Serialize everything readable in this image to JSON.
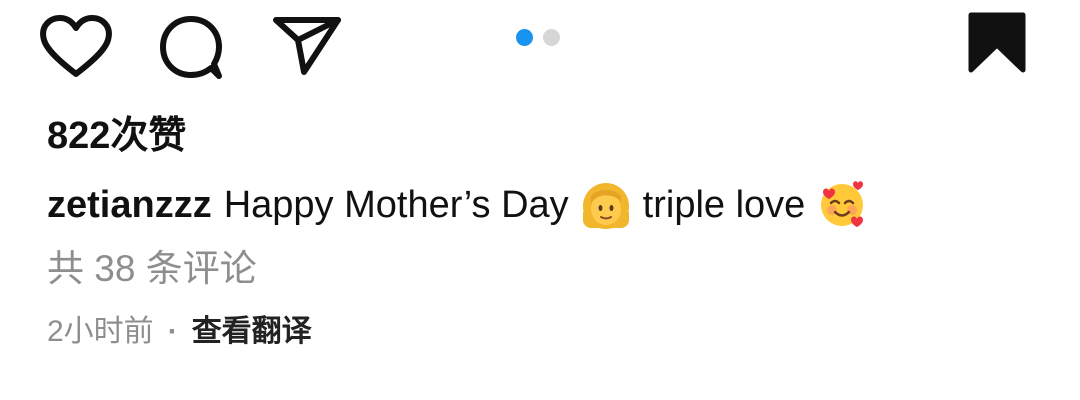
{
  "actions": {
    "like_icon": "heart-outline-icon",
    "comment_icon": "comment-bubble-icon",
    "share_icon": "paper-plane-icon",
    "save_icon": "bookmark-filled-icon"
  },
  "carousel": {
    "total": 2,
    "active_index": 0,
    "active_color": "#1a93f0",
    "inactive_color": "#d6d6d6"
  },
  "likes": {
    "text": "822次赞"
  },
  "caption": {
    "username": "zetianzzz",
    "text_1": "Happy Mother’s Day",
    "emoji_1": "woman-blond-emoji",
    "text_2": "triple love",
    "emoji_2": "smiling-face-with-hearts-emoji"
  },
  "comments": {
    "link_text": "共 38 条评论"
  },
  "meta": {
    "time": "2小时前",
    "separator": "·",
    "translate_label": "查看翻译"
  }
}
